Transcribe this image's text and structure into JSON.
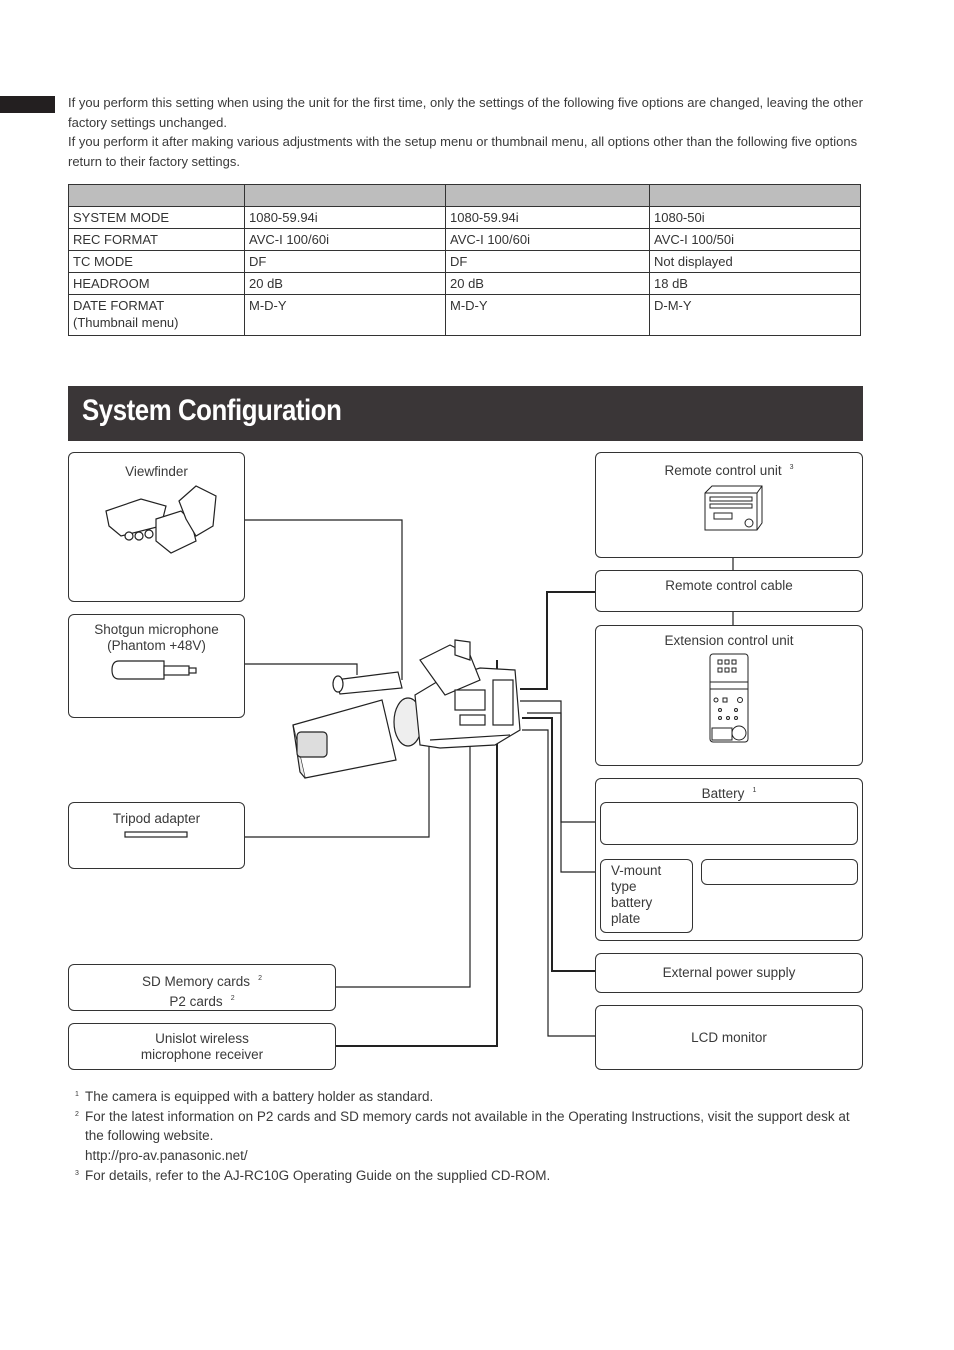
{
  "intro": {
    "para1": "If you perform this setting when using the unit for the first time, only the settings of the following five options are changed, leaving the other factory settings unchanged.",
    "para2": "If you perform it after making various adjustments with the setup menu or thumbnail menu, all options other than the following five options return to their factory settings."
  },
  "table": {
    "headers": [
      "",
      "",
      "",
      ""
    ],
    "rows": [
      [
        "SYSTEM MODE",
        "1080-59.94i",
        "1080-59.94i",
        "1080-50i"
      ],
      [
        "REC FORMAT",
        "AVC-I 100/60i",
        "AVC-I 100/60i",
        "AVC-I 100/50i"
      ],
      [
        "TC MODE",
        "DF",
        "DF",
        "Not displayed"
      ],
      [
        "HEADROOM",
        "20 dB",
        "20 dB",
        "18 dB"
      ],
      [
        "DATE FORMAT\n(Thumbnail menu)",
        "M-D-Y",
        "M-D-Y",
        "D-M-Y"
      ]
    ]
  },
  "section": {
    "title": "System Configuration"
  },
  "diagram": {
    "viewfinder": "Viewfinder",
    "shotgun_line1": "Shotgun microphone",
    "shotgun_line2": "(Phantom +48V)",
    "tripod": "Tripod adapter",
    "sd_cards": "SD Memory cards",
    "sd_cards_note": "2",
    "p2_cards": "P2 cards",
    "p2_cards_note": "2",
    "unislot_line1": "Unislot wireless",
    "unislot_line2": "microphone receiver",
    "remote_unit": "Remote control unit",
    "remote_unit_note": "3",
    "remote_cable": "Remote control cable",
    "extension_unit": "Extension control unit",
    "battery": "Battery",
    "battery_note": "1",
    "vmount_lines": [
      "V-mount",
      "type",
      "battery",
      "plate"
    ],
    "external_power": "External power supply",
    "lcd_monitor": "LCD monitor"
  },
  "footnotes": [
    {
      "num": "1",
      "text": "The camera is equipped with a battery holder as standard."
    },
    {
      "num": "2",
      "text": "For the latest information on P2 cards and SD memory cards not available in the Operating Instructions, visit the support desk at the following website.",
      "url": "http://pro-av.panasonic.net/"
    },
    {
      "num": "3",
      "text": "For details, refer to the AJ-RC10G Operating Guide on the supplied CD-ROM."
    }
  ]
}
